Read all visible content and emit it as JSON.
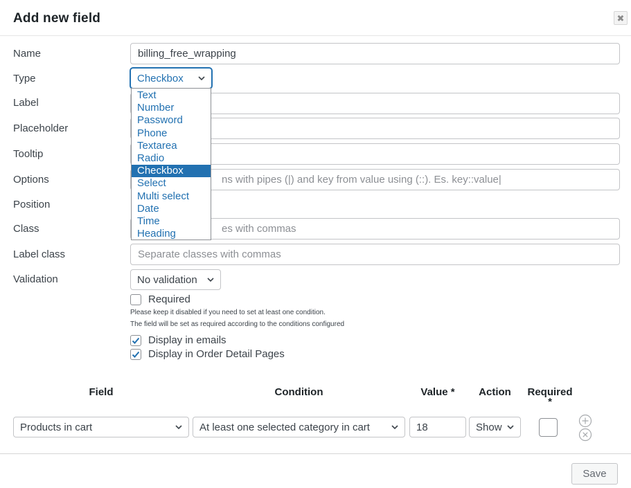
{
  "dialog": {
    "title": "Add new field",
    "close_glyph": "✖"
  },
  "form": {
    "name": {
      "label": "Name",
      "value": "billing_free_wrapping"
    },
    "type": {
      "label": "Type",
      "value": "Checkbox",
      "options": [
        "Text",
        "Number",
        "Password",
        "Phone",
        "Textarea",
        "Radio",
        "Checkbox",
        "Select",
        "Multi select",
        "Date",
        "Time",
        "Heading"
      ],
      "selected_index": 6
    },
    "label_field": {
      "label": "Label"
    },
    "placeholder_field": {
      "label": "Placeholder"
    },
    "tooltip_field": {
      "label": "Tooltip"
    },
    "options_field": {
      "label": "Options",
      "placeholder_visible": "ns with pipes (|) and key from value using (::). Es. key::value|"
    },
    "position_field": {
      "label": "Position"
    },
    "class_field": {
      "label": "Class",
      "placeholder_visible": "es with commas"
    },
    "label_class_field": {
      "label": "Label class",
      "placeholder": "Separate classes with commas"
    },
    "validation": {
      "label": "Validation",
      "value": "No validation"
    },
    "required": {
      "label": "Required",
      "checked": false,
      "note1": "Please keep it disabled if you need to set at least one condition.",
      "note2": "The field will be set as required according to the conditions configured"
    },
    "display_emails": {
      "label": "Display in emails",
      "checked": true
    },
    "display_order": {
      "label": "Display in Order Detail Pages",
      "checked": true
    }
  },
  "conditions": {
    "headers": {
      "field": "Field",
      "condition": "Condition",
      "value": "Value *",
      "action": "Action",
      "required_line1": "Required",
      "required_line2": "*"
    },
    "row": {
      "field": "Products in cart",
      "condition": "At least one selected category in cart",
      "value": "18",
      "action": "Show"
    }
  },
  "footer": {
    "save_label": "Save"
  },
  "colors": {
    "accent": "#2271b1",
    "border": "#c3c4c7",
    "text": "#3c434a"
  }
}
